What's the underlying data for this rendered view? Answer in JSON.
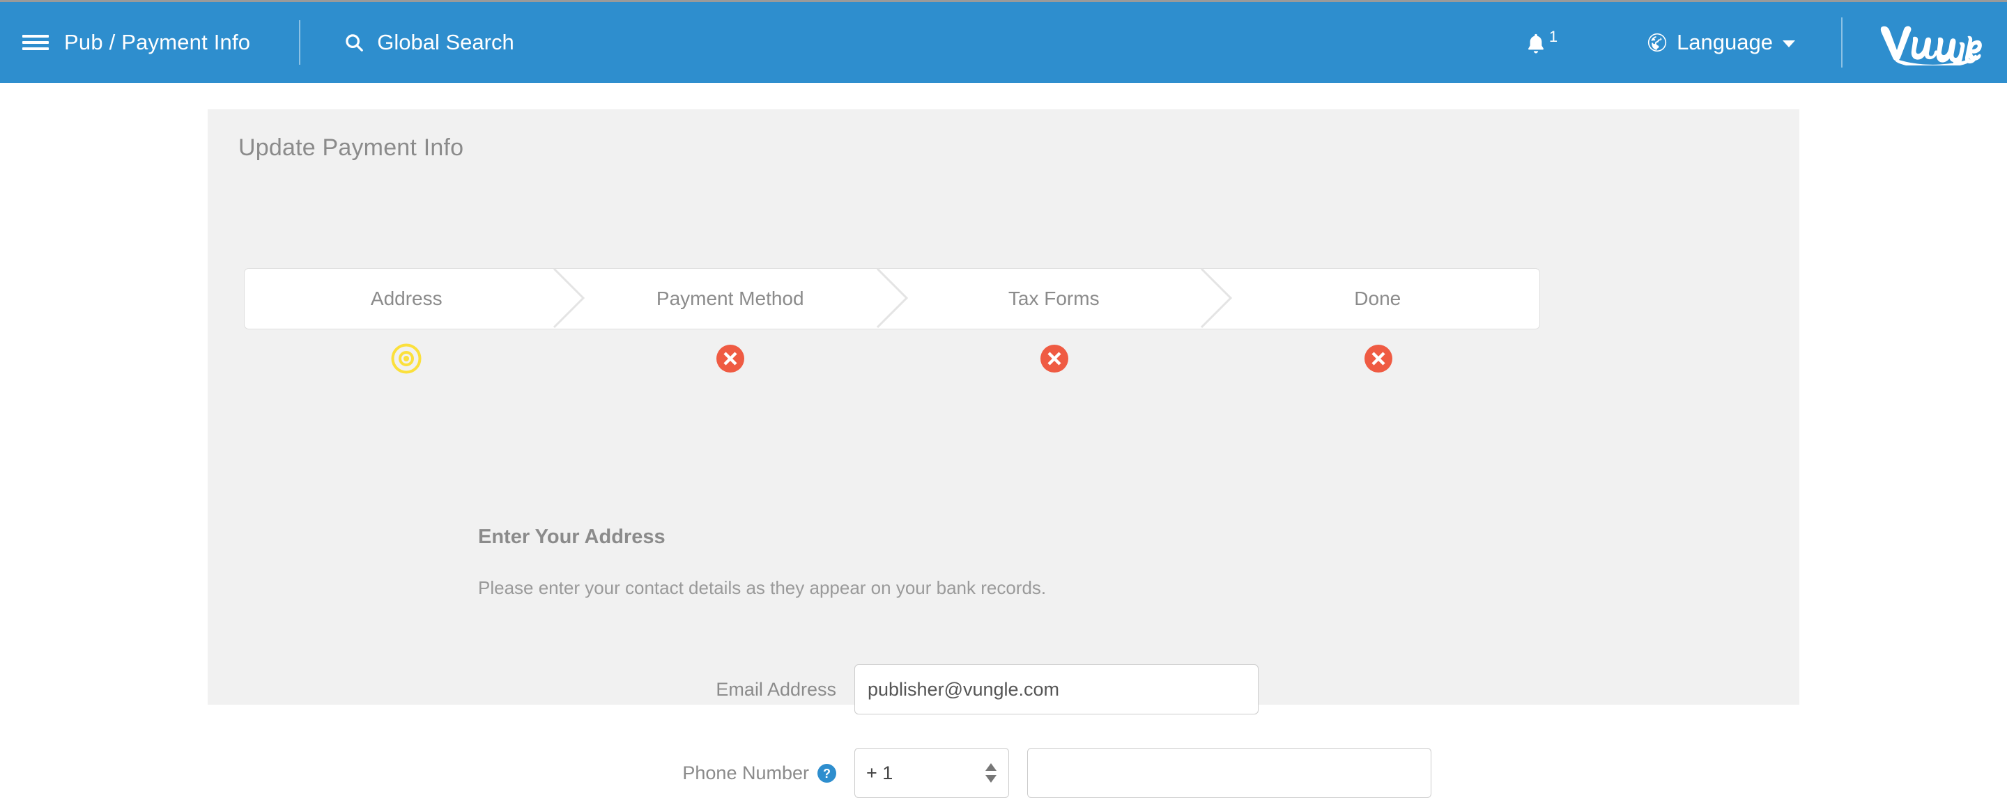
{
  "header": {
    "menu_icon": "hamburger-icon",
    "breadcrumb": "Pub / Payment Info",
    "search": {
      "icon": "search-icon",
      "label": "Global Search"
    },
    "notifications": {
      "icon": "bell-icon",
      "count": "1"
    },
    "language": {
      "icon": "globe-icon",
      "label": "Language",
      "caret": "chevron-down-icon"
    },
    "logo": {
      "name": "vungle-logo",
      "text": "Vungle"
    },
    "bg_color": "#2e8ece"
  },
  "card": {
    "title": "Update Payment Info",
    "bg_color": "#f1f1f1"
  },
  "wizard": {
    "steps": [
      {
        "label": "Address",
        "status": "current",
        "status_icon": "dot-circle-icon",
        "status_color": "#fbe03c"
      },
      {
        "label": "Payment Method",
        "status": "error",
        "status_icon": "times-circle-icon",
        "status_color": "#ef5b43"
      },
      {
        "label": "Tax Forms",
        "status": "error",
        "status_icon": "times-circle-icon",
        "status_color": "#ef5b43"
      },
      {
        "label": "Done",
        "status": "error",
        "status_icon": "times-circle-icon",
        "status_color": "#ef5b43"
      }
    ]
  },
  "form": {
    "heading": "Enter Your Address",
    "subtext": "Please enter your contact details as they appear on your bank records.",
    "email": {
      "label": "Email Address",
      "value": "publisher@vungle.com",
      "placeholder": ""
    },
    "phone": {
      "label": "Phone Number",
      "help_icon": "question-circle-icon",
      "country_code": "+ 1",
      "country_code_options": [
        "+ 1"
      ],
      "number_value": "",
      "number_placeholder": ""
    }
  }
}
